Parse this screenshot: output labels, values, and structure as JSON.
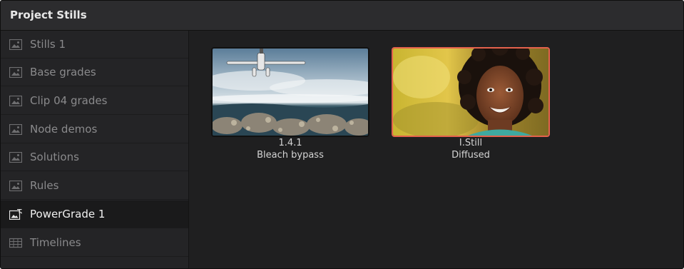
{
  "window": {
    "title": "Project Stills"
  },
  "sidebar": {
    "items": [
      {
        "label": "Stills 1",
        "icon": "album-icon",
        "selected": false
      },
      {
        "label": "Base grades",
        "icon": "album-icon",
        "selected": false
      },
      {
        "label": "Clip 04 grades",
        "icon": "album-icon",
        "selected": false
      },
      {
        "label": "Node demos",
        "icon": "album-icon",
        "selected": false
      },
      {
        "label": "Solutions",
        "icon": "album-icon",
        "selected": false
      },
      {
        "label": "Rules",
        "icon": "album-icon",
        "selected": false
      },
      {
        "label": "PowerGrade 1",
        "icon": "powergrade-album-icon",
        "selected": true
      },
      {
        "label": "Timelines",
        "icon": "timeline-album-icon",
        "selected": false
      }
    ]
  },
  "stills": [
    {
      "number": "1.4.1",
      "name": "Bleach bypass",
      "selected": false
    },
    {
      "number": "I.Still",
      "name": "Diffused",
      "selected": true
    }
  ],
  "colors": {
    "selection_border": "#e4614c",
    "panel_background": "#1f1f20",
    "title_bar": "#2c2c2e",
    "sidebar_text": "#8a8a8c",
    "sidebar_selected_text": "#f0f0f0"
  }
}
